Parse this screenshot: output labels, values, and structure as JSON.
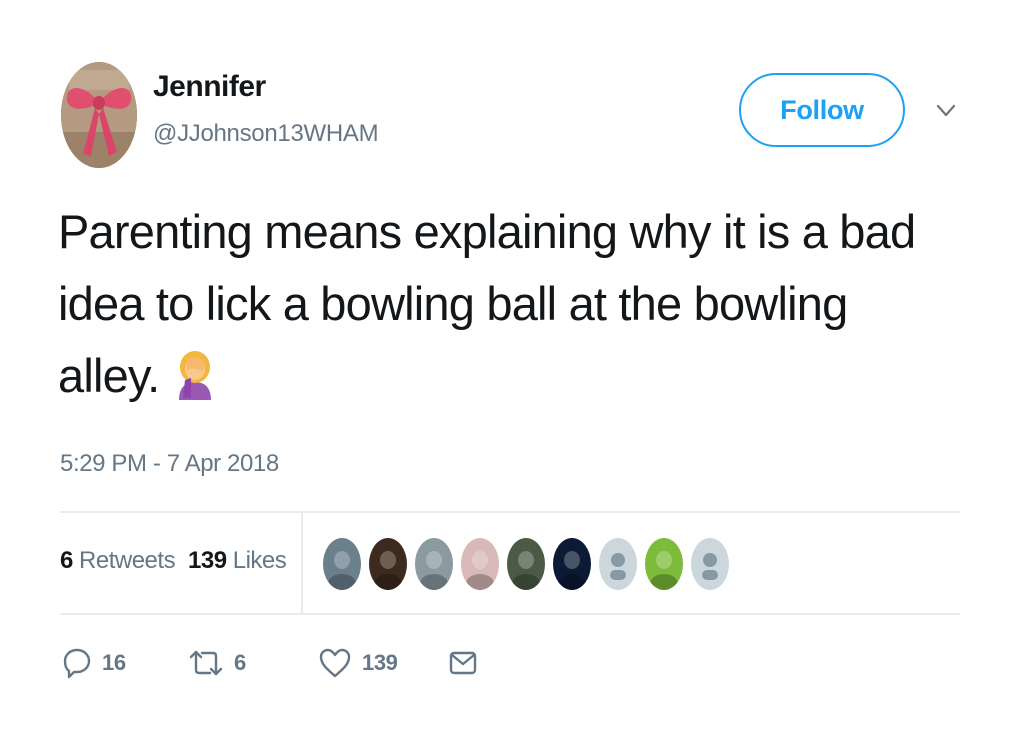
{
  "user": {
    "display_name": "Jennifer",
    "handle": "@JJohnson13WHAM",
    "avatar_icon": "avatar-bow-photo"
  },
  "header": {
    "follow_label": "Follow",
    "more_icon": "chevron-down-icon"
  },
  "tweet": {
    "text_line_1": "Parenting means explaining why it is a bad",
    "text_line_2": "idea to lick a bowling ball at the bowling",
    "text_line_3": "alley.",
    "emoji": "woman-facepalming-emoji",
    "timestamp": "5:29 PM - 7 Apr 2018"
  },
  "stats": {
    "retweets_count": "6",
    "retweets_label": "Retweets",
    "likes_count": "139",
    "likes_label": "Likes",
    "likers": [
      {
        "name": "liker-avatar-1",
        "color": "#6b7f8c"
      },
      {
        "name": "liker-avatar-2",
        "color": "#3d2a1e"
      },
      {
        "name": "liker-avatar-3",
        "color": "#8a9aa0"
      },
      {
        "name": "liker-avatar-4",
        "color": "#d9b8b8"
      },
      {
        "name": "liker-avatar-5",
        "color": "#4a5a44"
      },
      {
        "name": "liker-avatar-6",
        "color": "#0d1a35"
      },
      {
        "name": "liker-avatar-7",
        "color": "#ccd6dd"
      },
      {
        "name": "liker-avatar-8",
        "color": "#7dbb3a"
      },
      {
        "name": "liker-avatar-9",
        "color": "#ccd6dd"
      }
    ]
  },
  "actions": {
    "reply_count": "16",
    "retweet_count": "6",
    "like_count": "139",
    "reply_icon": "reply-icon",
    "retweet_icon": "retweet-icon",
    "like_icon": "heart-icon",
    "dm_icon": "envelope-icon"
  },
  "colors": {
    "accent": "#1da1f2",
    "text": "#14171a",
    "muted": "#657786",
    "divider": "#e6ecf0"
  }
}
